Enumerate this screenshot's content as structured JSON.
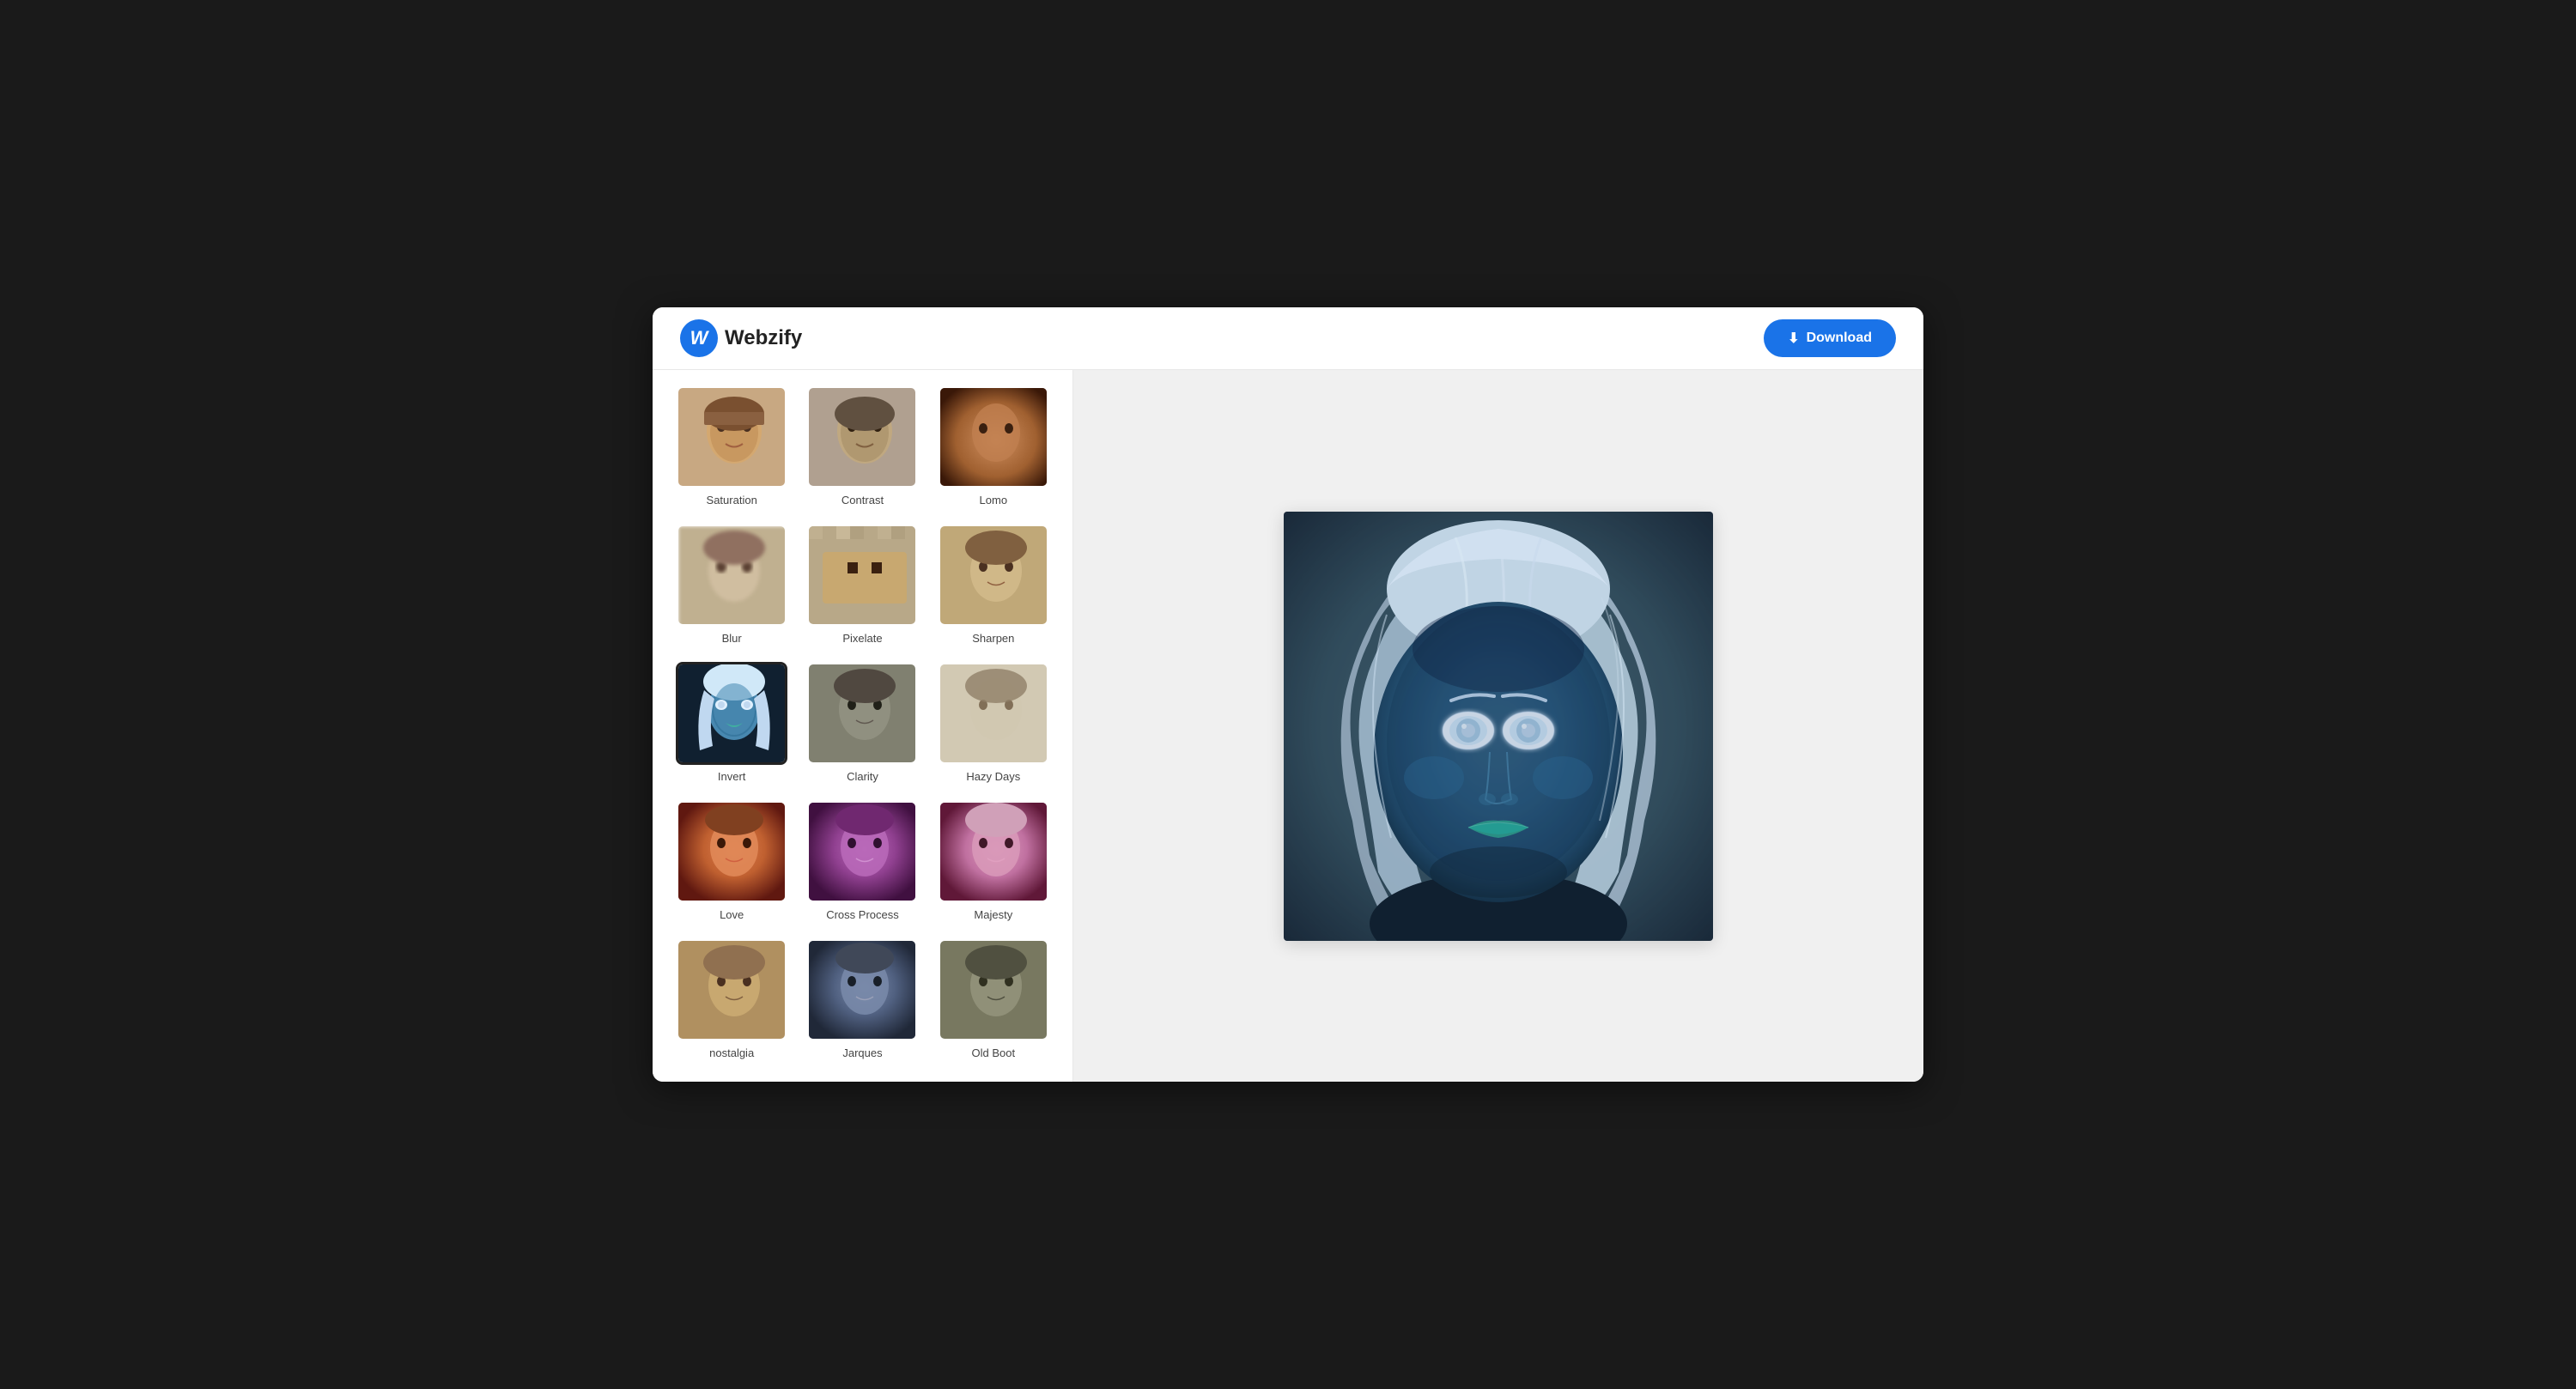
{
  "app": {
    "title": "Webzify",
    "logo_letter": "W"
  },
  "header": {
    "download_label": "Download"
  },
  "filters": [
    {
      "id": "saturation",
      "label": "Saturation",
      "style": "saturation",
      "active": false
    },
    {
      "id": "contrast",
      "label": "Contrast",
      "style": "contrast",
      "active": false
    },
    {
      "id": "lomo",
      "label": "Lomo",
      "style": "lomo",
      "active": false
    },
    {
      "id": "blur",
      "label": "Blur",
      "style": "blur",
      "active": false
    },
    {
      "id": "pixelate",
      "label": "Pixelate",
      "style": "pixelate",
      "active": false
    },
    {
      "id": "sharpen",
      "label": "Sharpen",
      "style": "sharpen",
      "active": false
    },
    {
      "id": "invert",
      "label": "Invert",
      "style": "invert",
      "active": true
    },
    {
      "id": "clarity",
      "label": "Clarity",
      "style": "clarity",
      "active": false
    },
    {
      "id": "hazy-days",
      "label": "Hazy Days",
      "style": "hazy",
      "active": false
    },
    {
      "id": "love",
      "label": "Love",
      "style": "love",
      "active": false
    },
    {
      "id": "cross-process",
      "label": "Cross Process",
      "style": "cross-process",
      "active": false
    },
    {
      "id": "majesty",
      "label": "Majesty",
      "style": "majesty",
      "active": false
    },
    {
      "id": "nostalgia",
      "label": "nostalgia",
      "style": "nostalgia",
      "active": false
    },
    {
      "id": "jarques",
      "label": "Jarques",
      "style": "jarques",
      "active": false
    },
    {
      "id": "old-boot",
      "label": "Old Boot",
      "style": "old-boot",
      "active": false
    }
  ],
  "preview": {
    "alt": "Portrait with Invert filter applied - blue toned face with white hair"
  }
}
